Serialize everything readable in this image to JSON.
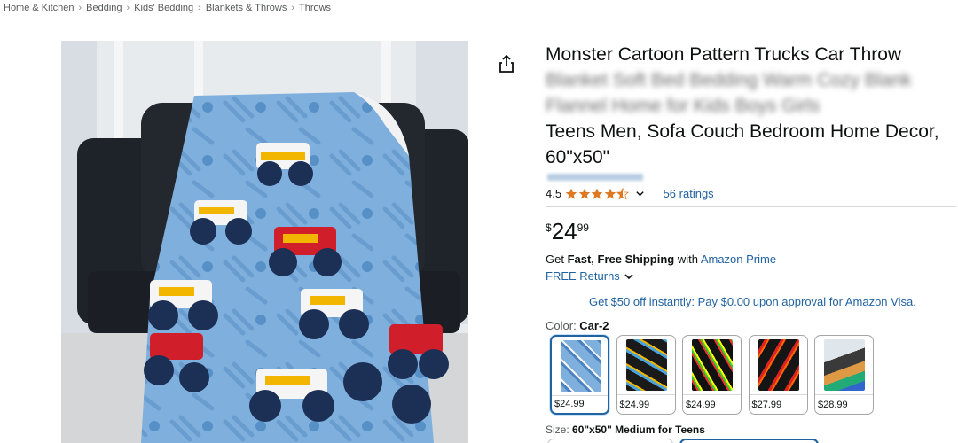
{
  "breadcrumb": [
    "Home & Kitchen",
    "Bedding",
    "Kids' Bedding",
    "Blankets & Throws",
    "Throws"
  ],
  "product": {
    "title_line1": "Monster Cartoon Pattern Trucks Car Throw",
    "title_line2_blurred": "Blanket Soft Bed Bedding Warm Cozy Blank",
    "title_line3_blurred": "Flannel Home for Kids Boys Girls",
    "title_line4": "Teens Men, Sofa Couch Bedroom Home Decor,",
    "title_line5": "60\"x50\""
  },
  "rating": {
    "value": "4.5",
    "stars": 4.5,
    "count_label": "56 ratings"
  },
  "price": {
    "symbol": "$",
    "whole": "24",
    "fraction": "99"
  },
  "shipping": {
    "prefix": "Get ",
    "bold": "Fast, Free Shipping",
    "middle": " with ",
    "prime": "Amazon Prime"
  },
  "returns_label": "FREE Returns",
  "visa_offer": "Get $50 off instantly: Pay $0.00 upon approval for Amazon Visa.",
  "color": {
    "label": "Color: ",
    "selected": "Car-2",
    "options": [
      {
        "price": "$24.99",
        "selected": true
      },
      {
        "price": "$24.99",
        "selected": false
      },
      {
        "price": "$24.99",
        "selected": false
      },
      {
        "price": "$27.99",
        "selected": false
      },
      {
        "price": "$28.99",
        "selected": false
      }
    ]
  },
  "size": {
    "label": "Size: ",
    "selected": "60\"x50\" Medium for Teens"
  },
  "colors": {
    "link": "#2162a1",
    "star": "#de7921",
    "selected_border": "#2162a1"
  }
}
